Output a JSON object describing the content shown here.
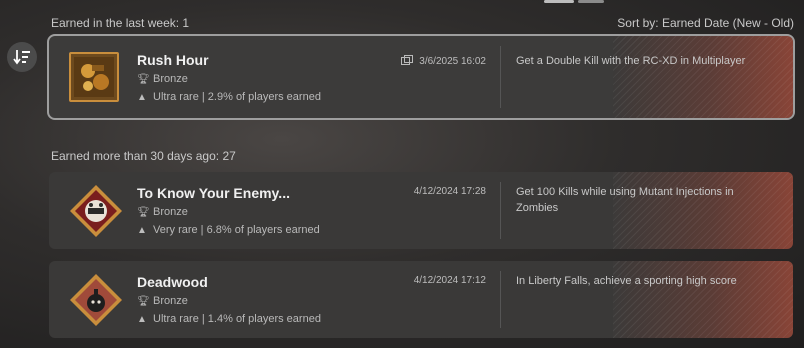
{
  "header": {
    "earned_recent_label": "Earned in the last week: 1",
    "sort_label": "Sort by: Earned Date (New - Old)"
  },
  "older_section_label": "Earned more than 30 days ago: 27",
  "icons": {
    "sort": "sort-descending-icon",
    "trophy": "trophy-icon",
    "rarity": "rarity-icon",
    "screenshot": "screenshot-icon"
  },
  "trophies": [
    {
      "title": "Rush Hour",
      "grade": "Bronze",
      "rarity": "Ultra rare | 2.9% of players earned",
      "date": "3/6/2025 16:02",
      "has_screenshot": true,
      "description": "Get a Double Kill with the RC-XD in Multiplayer",
      "selected": true
    },
    {
      "title": "To Know Your Enemy...",
      "grade": "Bronze",
      "rarity": "Very rare | 6.8% of players earned",
      "date": "4/12/2024 17:28",
      "has_screenshot": false,
      "description": "Get 100 Kills while using Mutant Injections in Zombies",
      "selected": false
    },
    {
      "title": "Deadwood",
      "grade": "Bronze",
      "rarity": "Ultra rare | 1.4% of players earned",
      "date": "4/12/2024 17:12",
      "has_screenshot": false,
      "description": "In Liberty Falls, achieve a sporting high score",
      "selected": false
    }
  ],
  "colors": {
    "card_bg": "#3a3938",
    "selected_border": "#9e9e9e",
    "accent_stripe": "#9a4637",
    "bronze": "#c98e3c"
  }
}
